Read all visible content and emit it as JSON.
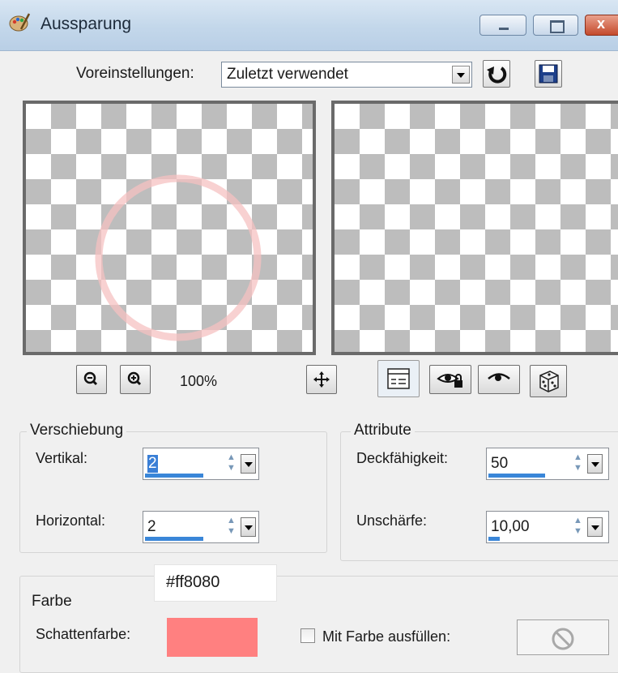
{
  "window": {
    "title": "Aussparung",
    "icon": "paint-palette-icon",
    "controls": [
      "minimize-icon",
      "maximize-icon",
      "close-icon"
    ]
  },
  "presets": {
    "label": "Voreinstellungen:",
    "selected": "Zuletzt verwendet"
  },
  "preview": {
    "zoom_level": "100%"
  },
  "offset": {
    "group_label": "Verschiebung",
    "vertical_label": "Vertikal:",
    "vertical_value": "2",
    "horizontal_label": "Horizontal:",
    "horizontal_value": "2"
  },
  "attributes": {
    "group_label": "Attribute",
    "opacity_label": "Deckfähigkeit:",
    "opacity_value": "50",
    "blur_label": "Unschärfe:",
    "blur_value": "10,00"
  },
  "color": {
    "group_label": "Farbe",
    "tooltip_hex": "#ff8080",
    "shadow_color_label": "Schattenfarbe:",
    "shadow_color": "#ff8080",
    "fill_label": "Mit Farbe ausfüllen:",
    "fill_checked": false
  }
}
